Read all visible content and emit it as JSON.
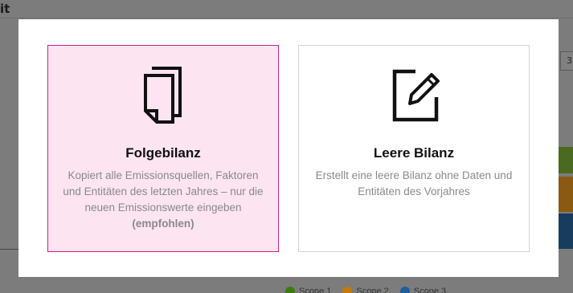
{
  "background": {
    "title": "it",
    "input_value": "3",
    "legend": [
      {
        "label": "Scope 1",
        "color": "#3c7a0f"
      },
      {
        "label": "Scope 2",
        "color": "#c57a05"
      },
      {
        "label": "Scope 3",
        "color": "#1f5fa0"
      }
    ]
  },
  "modal": {
    "options": [
      {
        "title": "Folgebilanz",
        "description": "Kopiert alle Emissionsquellen, Faktoren und Entitäten des letzten Jahres – nur die neuen Emissionswerte eingeben",
        "note": "(empfohlen)",
        "icon": "copy-documents-icon"
      },
      {
        "title": "Leere Bilanz",
        "description": "Erstellt eine leere Bilanz ohne Daten und Entitäten des Vorjahres",
        "icon": "edit-document-icon"
      }
    ]
  }
}
